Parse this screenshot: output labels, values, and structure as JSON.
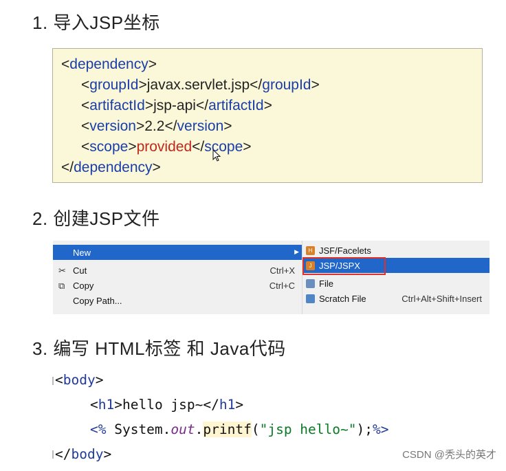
{
  "headings": {
    "step1": "1. 导入JSP坐标",
    "step2": "2. 创建JSP文件",
    "step3": "3. 编写 HTML标签 和 Java代码"
  },
  "xml": {
    "dependency_open": "dependency",
    "groupId_tag": "groupId",
    "groupId_value": "javax.servlet.jsp",
    "artifactId_tag": "artifactId",
    "artifactId_value": "jsp-api",
    "version_tag": "version",
    "version_value": "2.2",
    "scope_tag": "scope",
    "scope_value": "provided",
    "dependency_close": "dependency"
  },
  "context_menu": {
    "left": [
      {
        "label": "New",
        "shortcut": "",
        "icon": "",
        "selected": true
      },
      {
        "label": "Cut",
        "shortcut": "Ctrl+X",
        "icon": "scissors-icon"
      },
      {
        "label": "Copy",
        "shortcut": "Ctrl+C",
        "icon": "copy-icon"
      },
      {
        "label": "Copy Path...",
        "shortcut": "",
        "icon": ""
      }
    ],
    "submenu": [
      {
        "label": "JSF/Facelets",
        "shortcut": "",
        "icon": "jsf-icon",
        "icon_color": "#d9802a"
      },
      {
        "label": "JSP/JSPX",
        "shortcut": "",
        "icon": "jsp-icon",
        "icon_color": "#d9802a",
        "selected": true
      },
      {
        "label": "File",
        "shortcut": "",
        "icon": "file-icon",
        "icon_color": "#6a8fbf"
      },
      {
        "label": "Scratch File",
        "shortcut": "Ctrl+Alt+Shift+Insert",
        "icon": "scratch-file-icon",
        "icon_color": "#4f86c6"
      }
    ]
  },
  "code": {
    "body_open": "body",
    "h1_tag": "h1",
    "h1_text": "hello jsp~",
    "scriptlet_open": "<%",
    "system": " System.",
    "out": "out",
    "dot": ".",
    "printf": "printf",
    "paren_open": "(",
    "str": "\"jsp hello~\"",
    "paren_close": ");",
    "scriptlet_close": "%>",
    "body_close": "body"
  },
  "watermark": "CSDN @秃头的英才"
}
